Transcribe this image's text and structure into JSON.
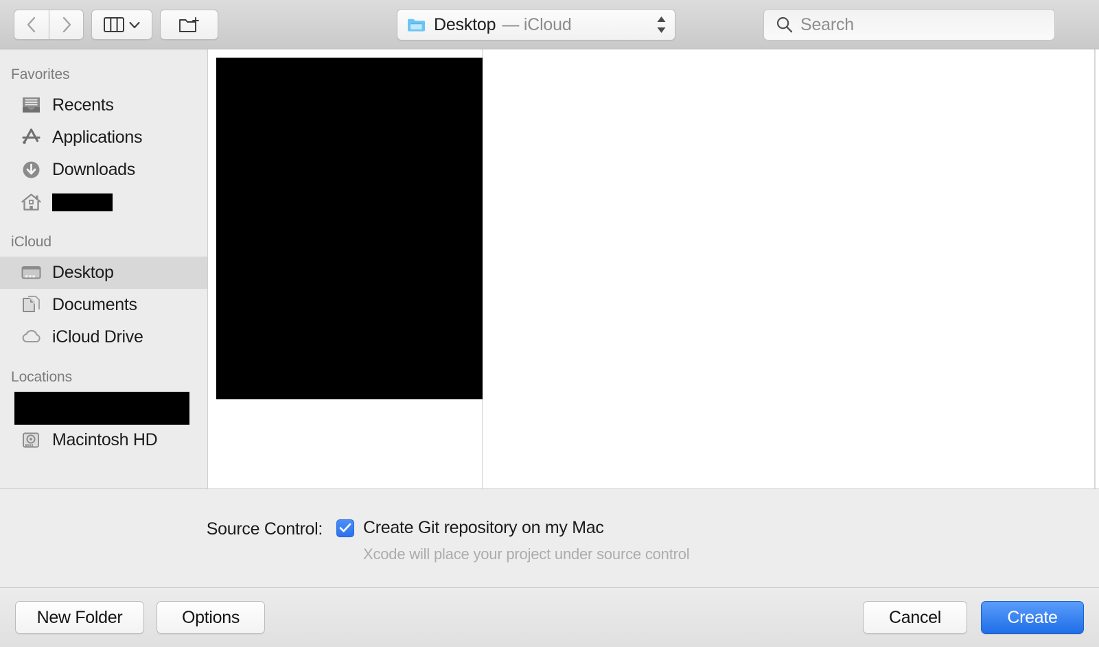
{
  "toolbar": {
    "back_label": "Back",
    "forward_label": "Forward",
    "view_label": "Column View",
    "new_folder_label": "New Folder",
    "path": {
      "title": "Desktop",
      "subtitle": "— iCloud",
      "icon": "folder-icon"
    },
    "search": {
      "placeholder": "Search",
      "value": "",
      "icon": "search-icon"
    }
  },
  "sidebar": {
    "sections": [
      {
        "header": "Favorites",
        "items": [
          {
            "label": "Recents",
            "icon": "recents-tray-icon",
            "selected": false,
            "redacted": false
          },
          {
            "label": "Applications",
            "icon": "applications-icon",
            "selected": false,
            "redacted": false
          },
          {
            "label": "Downloads",
            "icon": "downloads-icon",
            "selected": false,
            "redacted": false
          },
          {
            "label": "",
            "icon": "home-icon",
            "selected": false,
            "redacted": true
          }
        ]
      },
      {
        "header": "iCloud",
        "items": [
          {
            "label": "Desktop",
            "icon": "desktop-icon",
            "selected": true,
            "redacted": false
          },
          {
            "label": "Documents",
            "icon": "documents-icon",
            "selected": false,
            "redacted": false
          },
          {
            "label": "iCloud Drive",
            "icon": "cloud-icon",
            "selected": false,
            "redacted": false
          }
        ]
      },
      {
        "header": "Locations",
        "items": [
          {
            "label": "",
            "icon": "",
            "selected": false,
            "redacted": true,
            "block": true
          },
          {
            "label": "Macintosh HD",
            "icon": "hard-drive-icon",
            "selected": false,
            "redacted": false
          }
        ]
      }
    ]
  },
  "browser": {
    "column_one_redacted": true,
    "column_two_empty": true
  },
  "accessory": {
    "source_control_label": "Source Control:",
    "create_git_label": "Create Git repository on my Mac",
    "create_git_checked": true,
    "help_text": "Xcode will place your project under source control"
  },
  "footer": {
    "new_folder_label": "New Folder",
    "options_label": "Options",
    "cancel_label": "Cancel",
    "create_label": "Create"
  },
  "colors": {
    "accent": "#2a72ef",
    "sidebar_bg": "#ececec",
    "selection_bg": "#d8d8d8",
    "toolbar_bg": "#d2d2d2"
  }
}
